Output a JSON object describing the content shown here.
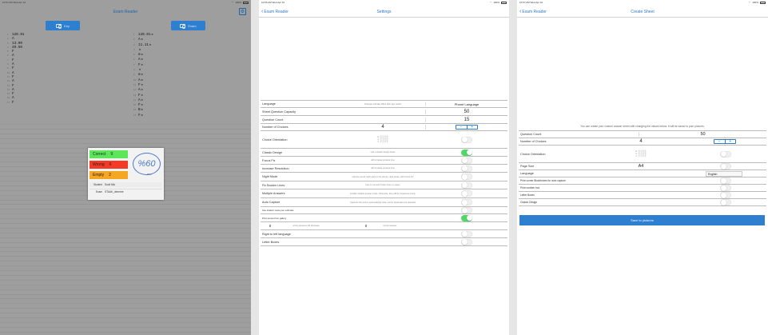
{
  "status": {
    "screen1": {
      "time": "10:57 AM",
      "date": "Wed Apr 10",
      "battery": "100%"
    },
    "screen2": {
      "time": "10:56 AM",
      "date": "Wed Apr 10",
      "battery": "100%"
    },
    "screen3": {
      "time": "10:57 AM",
      "date": "Wed Apr 10",
      "battery": "100%"
    }
  },
  "exam_reader": {
    "title": "Exam Reader",
    "key_label": "Key",
    "exam_label": "Exam",
    "key_answers": [
      "120.01",
      "A",
      "13.00",
      "40.50",
      "F",
      "A",
      "F",
      "A",
      "F",
      "A",
      "F",
      "A",
      "F",
      "A",
      "F",
      "A",
      "F"
    ],
    "exam_answers": [
      {
        "value": "120.01",
        "mark": "⊗"
      },
      {
        "value": "A",
        "mark": "⊗"
      },
      {
        "value": "11.11",
        "mark": "⊗"
      },
      {
        "value": "",
        "mark": "⊗"
      },
      {
        "value": "⊗",
        "mark": "⊗"
      },
      {
        "value": "A",
        "mark": "⊗"
      },
      {
        "value": "F",
        "mark": "⊗"
      },
      {
        "value": "",
        "mark": "⊗"
      },
      {
        "value": "⊗",
        "mark": "⊗"
      },
      {
        "value": "A",
        "mark": "⊗"
      },
      {
        "value": "F",
        "mark": "⊗"
      },
      {
        "value": "A",
        "mark": "⊗"
      },
      {
        "value": "F",
        "mark": "⊗"
      },
      {
        "value": "A",
        "mark": "⊗"
      },
      {
        "value": "F",
        "mark": "⊗"
      },
      {
        "value": "B",
        "mark": "⊗"
      },
      {
        "value": "F",
        "mark": "⊗"
      }
    ],
    "result": {
      "correct_label": "Correct",
      "correct_value": "9",
      "wrong_label": "Wrong",
      "wrong_value": "6",
      "empty_label": "Empty",
      "empty_value": "2",
      "score": "%60",
      "score_count": "9/6 ≡",
      "student_label": "Student",
      "student_value": "Sunil Mis",
      "exam_label": "Exam",
      "exam_value": "STAAK_deneme"
    }
  },
  "settings": {
    "back_label": "Exam Reader",
    "title": "Settings",
    "rows": {
      "language": {
        "label": "Language",
        "desc": "Changes will take effect after app restart",
        "value": "Phone Language"
      },
      "capacity": {
        "label": "Sheet Question Capacity",
        "value": "50"
      },
      "qcount": {
        "label": "Question Count",
        "value": "15"
      },
      "choices": {
        "label": "Number of Choices",
        "value": "4"
      },
      "orientation": {
        "label": "Choice Orientation",
        "lines": [
          "A ⓑⓒⓓⓔ",
          "1 ⓑⓒⓓⓔ",
          "1 ⓑⓒⓓⓔ"
        ]
      },
      "classic": {
        "label": "Classic Design",
        "desc": "Use a classic design sheet"
      },
      "focus": {
        "label": "Focus Fix",
        "desc": "will increase process time"
      },
      "resolution": {
        "label": "Increase Resolution",
        "desc": "will increase process time"
      },
      "night": {
        "label": "Night Mode",
        "desc": "reduces pencil mark glare in the picture, dark areas, with Focus Fix"
      },
      "fix_broken": {
        "label": "Fix Broken Lines",
        "desc": "tries to connect broken lines on paper"
      },
      "multiple": {
        "label": "Multiple Answers",
        "desc": "Enable multiple answer mode. Otherwise, they will be treated as empty"
      },
      "auto_capture": {
        "label": "Auto Capture",
        "desc": "Captures the picture automatically when corner landmarks are detected"
      },
      "use_student": {
        "label": "Use student name pen estimate"
      },
      "print_gallery": {
        "label": "Print scores from gallery"
      },
      "penalty": {
        "value1": "0",
        "desc1": "wrong answers will decrease",
        "value2": "0",
        "desc2": "correct answer"
      },
      "rtl": {
        "label": "Right to left language"
      },
      "letter_boxes": {
        "label": "Letter Boxes"
      }
    }
  },
  "create_sheet": {
    "back_label": "Exam Reader",
    "title": "Create Sheet",
    "intro": "You can create your custom answer sheet with changing the values below. It will be saved to your pictures.",
    "rows": {
      "qcount": {
        "label": "Question Count",
        "value": "50"
      },
      "choices": {
        "label": "Number of Choices",
        "value": "4"
      },
      "orientation": {
        "label": "Choice Orientation",
        "lines": [
          "A ⓑⓒⓓⓔ",
          "1 ⓑⓒⓓⓔ",
          "1 ⓑⓒⓓⓔ"
        ]
      },
      "page_size": {
        "label": "Page Size",
        "value": "A4"
      },
      "language": {
        "label": "Language",
        "value": "English"
      },
      "corner": {
        "label": "Print corner Blockboxes for auto capture"
      },
      "number_box": {
        "label": "Print number box"
      },
      "letter_boxes": {
        "label": "Letter Boxes"
      },
      "classic": {
        "label": "Classic Design"
      }
    },
    "save_label": "Save to pictures"
  }
}
